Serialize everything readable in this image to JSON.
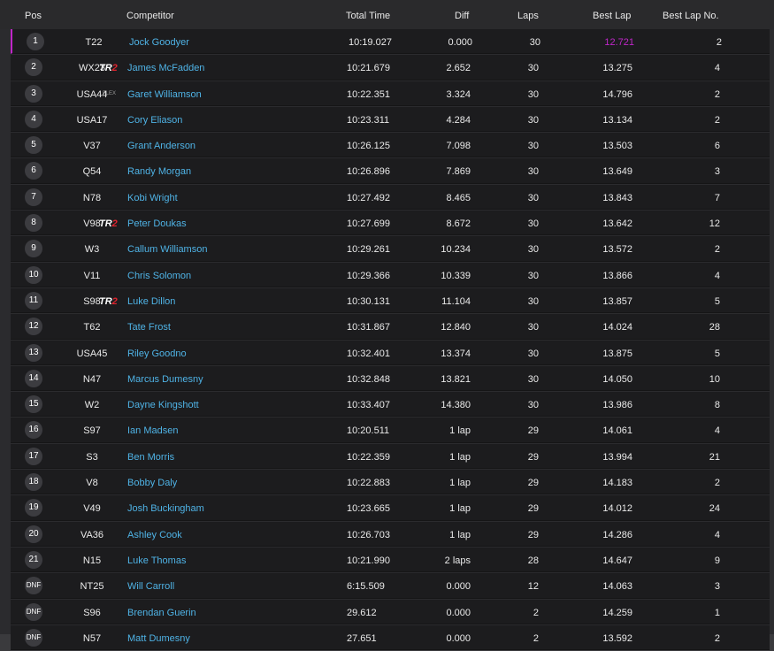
{
  "columns": {
    "pos": "Pos",
    "competitor": "Competitor",
    "total_time": "Total Time",
    "diff": "Diff",
    "laps": "Laps",
    "best_lap": "Best Lap",
    "best_lap_no": "Best Lap No."
  },
  "colors": {
    "accent_fastest": "#c026c9",
    "name_link": "#4fb3e6",
    "tag_red": "#e0242e"
  },
  "rows": [
    {
      "pos": "1",
      "number": "T22",
      "tag": "",
      "name": "Jock Goodyer",
      "time": "10:19.027",
      "diff": "0.000",
      "laps": "30",
      "best": "12.721",
      "best_no": "2",
      "fastest": true
    },
    {
      "pos": "2",
      "number": "WX23",
      "tag": "TR2",
      "name": "James McFadden",
      "time": "10:21.679",
      "diff": "2.652",
      "laps": "30",
      "best": "13.275",
      "best_no": "4"
    },
    {
      "pos": "3",
      "number": "USA44",
      "tag": "FLEX",
      "name": "Garet Williamson",
      "time": "10:22.351",
      "diff": "3.324",
      "laps": "30",
      "best": "14.796",
      "best_no": "2"
    },
    {
      "pos": "4",
      "number": "USA17",
      "tag": "",
      "name": "Cory Eliason",
      "time": "10:23.311",
      "diff": "4.284",
      "laps": "30",
      "best": "13.134",
      "best_no": "2"
    },
    {
      "pos": "5",
      "number": "V37",
      "tag": "",
      "name": "Grant Anderson",
      "time": "10:26.125",
      "diff": "7.098",
      "laps": "30",
      "best": "13.503",
      "best_no": "6"
    },
    {
      "pos": "6",
      "number": "Q54",
      "tag": "",
      "name": "Randy Morgan",
      "time": "10:26.896",
      "diff": "7.869",
      "laps": "30",
      "best": "13.649",
      "best_no": "3"
    },
    {
      "pos": "7",
      "number": "N78",
      "tag": "",
      "name": "Kobi Wright",
      "time": "10:27.492",
      "diff": "8.465",
      "laps": "30",
      "best": "13.843",
      "best_no": "7"
    },
    {
      "pos": "8",
      "number": "V98",
      "tag": "TR2",
      "name": "Peter Doukas",
      "time": "10:27.699",
      "diff": "8.672",
      "laps": "30",
      "best": "13.642",
      "best_no": "12"
    },
    {
      "pos": "9",
      "number": "W3",
      "tag": "",
      "name": "Callum Williamson",
      "time": "10:29.261",
      "diff": "10.234",
      "laps": "30",
      "best": "13.572",
      "best_no": "2"
    },
    {
      "pos": "10",
      "number": "V11",
      "tag": "",
      "name": "Chris Solomon",
      "time": "10:29.366",
      "diff": "10.339",
      "laps": "30",
      "best": "13.866",
      "best_no": "4"
    },
    {
      "pos": "11",
      "number": "S98",
      "tag": "TR2",
      "name": "Luke Dillon",
      "time": "10:30.131",
      "diff": "11.104",
      "laps": "30",
      "best": "13.857",
      "best_no": "5"
    },
    {
      "pos": "12",
      "number": "T62",
      "tag": "",
      "name": "Tate Frost",
      "time": "10:31.867",
      "diff": "12.840",
      "laps": "30",
      "best": "14.024",
      "best_no": "28"
    },
    {
      "pos": "13",
      "number": "USA45",
      "tag": "",
      "name": "Riley Goodno",
      "time": "10:32.401",
      "diff": "13.374",
      "laps": "30",
      "best": "13.875",
      "best_no": "5"
    },
    {
      "pos": "14",
      "number": "N47",
      "tag": "",
      "name": "Marcus Dumesny",
      "time": "10:32.848",
      "diff": "13.821",
      "laps": "30",
      "best": "14.050",
      "best_no": "10"
    },
    {
      "pos": "15",
      "number": "W2",
      "tag": "",
      "name": "Dayne Kingshott",
      "time": "10:33.407",
      "diff": "14.380",
      "laps": "30",
      "best": "13.986",
      "best_no": "8"
    },
    {
      "pos": "16",
      "number": "S97",
      "tag": "",
      "name": "Ian Madsen",
      "time": "10:20.511",
      "diff": "1 lap",
      "laps": "29",
      "best": "14.061",
      "best_no": "4"
    },
    {
      "pos": "17",
      "number": "S3",
      "tag": "",
      "name": "Ben Morris",
      "time": "10:22.359",
      "diff": "1 lap",
      "laps": "29",
      "best": "13.994",
      "best_no": "21"
    },
    {
      "pos": "18",
      "number": "V8",
      "tag": "",
      "name": "Bobby Daly",
      "time": "10:22.883",
      "diff": "1 lap",
      "laps": "29",
      "best": "14.183",
      "best_no": "2"
    },
    {
      "pos": "19",
      "number": "V49",
      "tag": "",
      "name": "Josh Buckingham",
      "time": "10:23.665",
      "diff": "1 lap",
      "laps": "29",
      "best": "14.012",
      "best_no": "24"
    },
    {
      "pos": "20",
      "number": "VA36",
      "tag": "",
      "name": "Ashley Cook",
      "time": "10:26.703",
      "diff": "1 lap",
      "laps": "29",
      "best": "14.286",
      "best_no": "4"
    },
    {
      "pos": "21",
      "number": "N15",
      "tag": "",
      "name": "Luke Thomas",
      "time": "10:21.990",
      "diff": "2 laps",
      "laps": "28",
      "best": "14.647",
      "best_no": "9"
    },
    {
      "pos": "DNF",
      "number": "NT25",
      "tag": "",
      "name": "Will Carroll",
      "time": "6:15.509",
      "diff": "0.000",
      "laps": "12",
      "best": "14.063",
      "best_no": "3"
    },
    {
      "pos": "DNF",
      "number": "S96",
      "tag": "",
      "name": "Brendan Guerin",
      "time": "29.612",
      "diff": "0.000",
      "laps": "2",
      "best": "14.259",
      "best_no": "1"
    },
    {
      "pos": "DNF",
      "number": "N57",
      "tag": "",
      "name": "Matt Dumesny",
      "time": "27.651",
      "diff": "0.000",
      "laps": "2",
      "best": "13.592",
      "best_no": "2"
    }
  ]
}
